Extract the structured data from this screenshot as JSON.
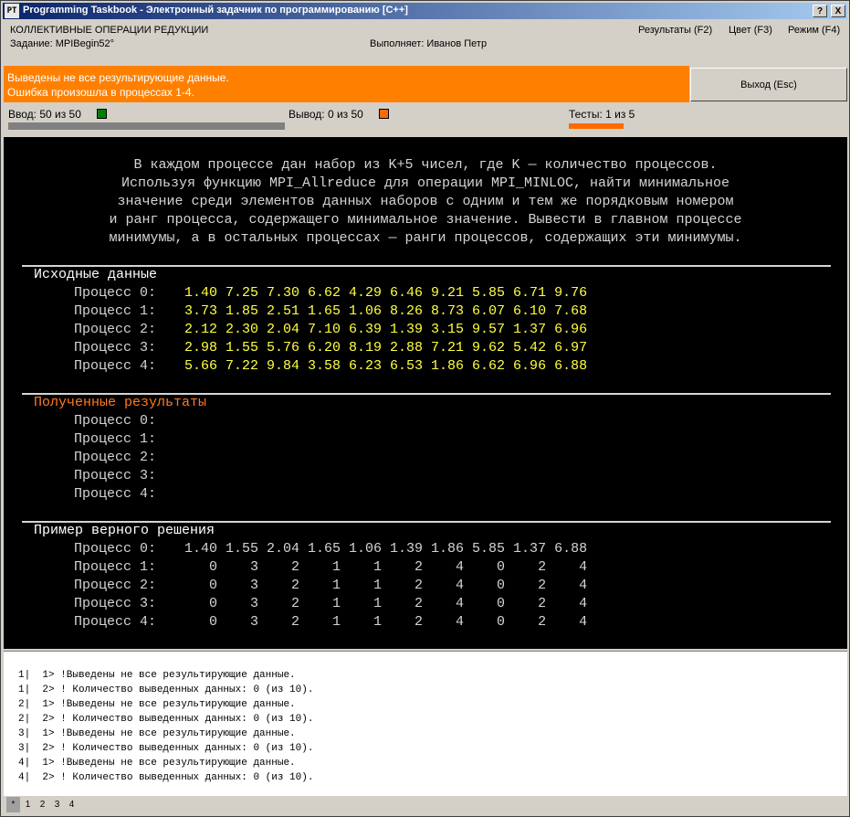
{
  "window": {
    "title": "Programming Taskbook - Электронный задачник по программированию [C++]",
    "icon_text": "PT",
    "buttons": [
      "?",
      "X"
    ]
  },
  "header": {
    "topic": "КОЛЛЕКТИВНЫЕ ОПЕРАЦИИ РЕДУКЦИИ",
    "task": "Задание: MPIBegin52°",
    "performer": "Выполняет: Иванов Петр",
    "menu": [
      "Результаты (F2)",
      "Цвет (F3)",
      "Режим (F4)"
    ]
  },
  "error": {
    "line1": "Выведены не все результирующие данные.",
    "line2": "Ошибка произошла в процессах 1-4.",
    "color": "#ff8000"
  },
  "exit_button": "Выход (Esc)",
  "status": {
    "input": "Ввод: 50 из 50",
    "output": "Вывод: 0 из 50",
    "tests": "Тесты: 1 из 5",
    "input_color": "#008000",
    "output_color": "#ff6a00"
  },
  "task_text": [
    "В каждом процессе дан набор из K+5 чисел, где K — количество процессов.",
    "Используя функцию MPI_Allreduce для операции MPI_MINLOC, найти минимальное",
    "значение среди элементов данных наборов с одним и тем же порядковым номером",
    "и ранг процесса, содержащего минимальное значение. Вывести в главном процессе",
    "минимумы, а в остальных процессах — ранги процессов, содержащих эти минимумы."
  ],
  "source": {
    "heading": "Исходные данные",
    "rows": [
      {
        "label": "Процесс 0:",
        "values": "1.40 7.25 7.30 6.62 4.29 6.46 9.21 5.85 6.71 9.76"
      },
      {
        "label": "Процесс 1:",
        "values": "3.73 1.85 2.51 1.65 1.06 8.26 8.73 6.07 6.10 7.68"
      },
      {
        "label": "Процесс 2:",
        "values": "2.12 2.30 2.04 7.10 6.39 1.39 3.15 9.57 1.37 6.96"
      },
      {
        "label": "Процесс 3:",
        "values": "2.98 1.55 5.76 6.20 8.19 2.88 7.21 9.62 5.42 6.97"
      },
      {
        "label": "Процесс 4:",
        "values": "5.66 7.22 9.84 3.58 6.23 6.53 1.86 6.62 6.96 6.88"
      }
    ]
  },
  "results": {
    "heading": "Полученные результаты",
    "rows": [
      "Процесс 0:",
      "Процесс 1:",
      "Процесс 2:",
      "Процесс 3:",
      "Процесс 4:"
    ]
  },
  "example": {
    "heading": "Пример верного решения",
    "rows": [
      {
        "label": "Процесс 0:",
        "values": "1.40 1.55 2.04 1.65 1.06 1.39 1.86 5.85 1.37 6.88"
      },
      {
        "label": "Процесс 1:",
        "values": "   0    3    2    1    1    2    4    0    2    4"
      },
      {
        "label": "Процесс 2:",
        "values": "   0    3    2    1    1    2    4    0    2    4"
      },
      {
        "label": "Процесс 3:",
        "values": "   0    3    2    1    1    2    4    0    2    4"
      },
      {
        "label": "Процесс 4:",
        "values": "   0    3    2    1    1    2    4    0    2    4"
      }
    ]
  },
  "log": [
    "1|  1> !Выведены не все результирующие данные.",
    "1|  2> ! Количество выведенных данных: 0 (из 10).",
    "2|  1> !Выведены не все результирующие данные.",
    "2|  2> ! Количество выведенных данных: 0 (из 10).",
    "3|  1> !Выведены не все результирующие данные.",
    "3|  2> ! Количество выведенных данных: 0 (из 10).",
    "4|  1> !Выведены не все результирующие данные.",
    "4|  2> ! Количество выведенных данных: 0 (из 10)."
  ],
  "log_tabs": [
    "*",
    "1",
    "2",
    "3",
    "4"
  ]
}
